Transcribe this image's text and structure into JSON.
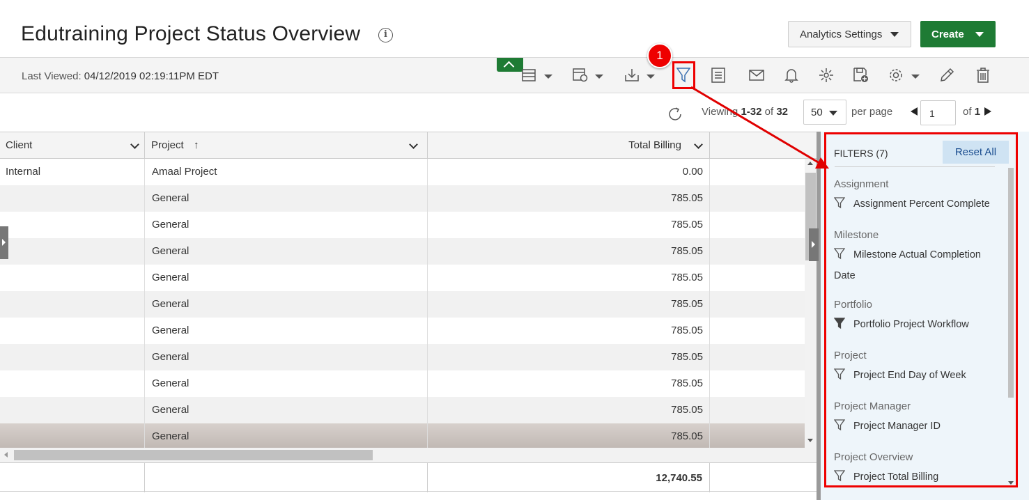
{
  "header": {
    "title": "Edutraining Project Status Overview",
    "analytics_settings_label": "Analytics Settings",
    "create_label": "Create"
  },
  "toolbar": {
    "last_viewed_label": "Last Viewed:",
    "last_viewed_value": "04/12/2019 02:19:11PM EDT",
    "badge_number": "1"
  },
  "pager": {
    "viewing_prefix": "Viewing",
    "viewing_range": "1-32",
    "viewing_of": "of",
    "viewing_total": "32",
    "per_page_value": "50",
    "per_page_label": "per page",
    "page_number": "1",
    "of_label": "of",
    "total_pages": "1"
  },
  "grid": {
    "columns": [
      "Client",
      "Project",
      "Total Billing"
    ],
    "sort_indicator": "↑",
    "rows": [
      {
        "client": "Internal",
        "project": "Amaal Project",
        "billing": "0.00"
      },
      {
        "client": "",
        "project": "General",
        "billing": "785.05"
      },
      {
        "client": "",
        "project": "General",
        "billing": "785.05"
      },
      {
        "client": "",
        "project": "General",
        "billing": "785.05"
      },
      {
        "client": "",
        "project": "General",
        "billing": "785.05"
      },
      {
        "client": "",
        "project": "General",
        "billing": "785.05"
      },
      {
        "client": "",
        "project": "General",
        "billing": "785.05"
      },
      {
        "client": "",
        "project": "General",
        "billing": "785.05"
      },
      {
        "client": "",
        "project": "General",
        "billing": "785.05"
      },
      {
        "client": "",
        "project": "General",
        "billing": "785.05"
      },
      {
        "client": "",
        "project": "General",
        "billing": "785.05"
      }
    ],
    "total_billing": "12,740.55"
  },
  "filters": {
    "title": "FILTERS (7)",
    "reset_label": "Reset All",
    "groups": [
      {
        "title": "Assignment",
        "item": "Assignment Percent Complete",
        "active": false
      },
      {
        "title": "Milestone",
        "item": "Milestone Actual Completion Date",
        "active": false
      },
      {
        "title": "Portfolio",
        "item": "Portfolio Project Workflow",
        "active": true
      },
      {
        "title": "Project",
        "item": "Project End Day of Week",
        "active": false
      },
      {
        "title": "Project Manager",
        "item": "Project Manager ID",
        "active": false
      },
      {
        "title": "Project Overview",
        "item": "Project Total Billing",
        "active": false
      }
    ]
  },
  "colors": {
    "brand_green": "#1e7b34",
    "annotation_red": "#e00000",
    "filter_panel_bg": "#eef5fa",
    "reset_button_bg": "#cfe3f3"
  },
  "icons": [
    "info-icon",
    "grid-view-icon",
    "report-icon",
    "download-icon",
    "filter-icon",
    "notes-icon",
    "email-icon",
    "bell-icon",
    "transform-icon",
    "save-as-icon",
    "gear-icon",
    "pencil-icon",
    "trash-icon",
    "refresh-icon"
  ]
}
